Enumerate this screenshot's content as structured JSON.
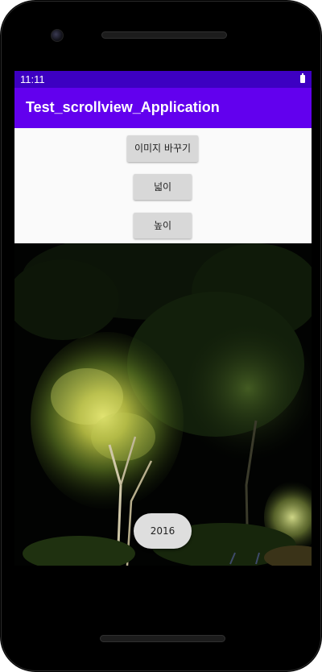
{
  "status_bar": {
    "time": "11:11"
  },
  "app_bar": {
    "title": "Test_scrollview_Application"
  },
  "buttons": {
    "change_image": "이미지 바꾸기",
    "width": "넓이",
    "height": "높이"
  },
  "fab": {
    "label": "2016"
  },
  "photo": {
    "subject": "night garden with illuminated tree"
  },
  "colors": {
    "status_bar": "#3d00c2",
    "app_bar": "#6200ee",
    "button": "#d8d8d8"
  },
  "icons": {
    "battery": "battery-icon",
    "camera": "front-camera-icon"
  }
}
